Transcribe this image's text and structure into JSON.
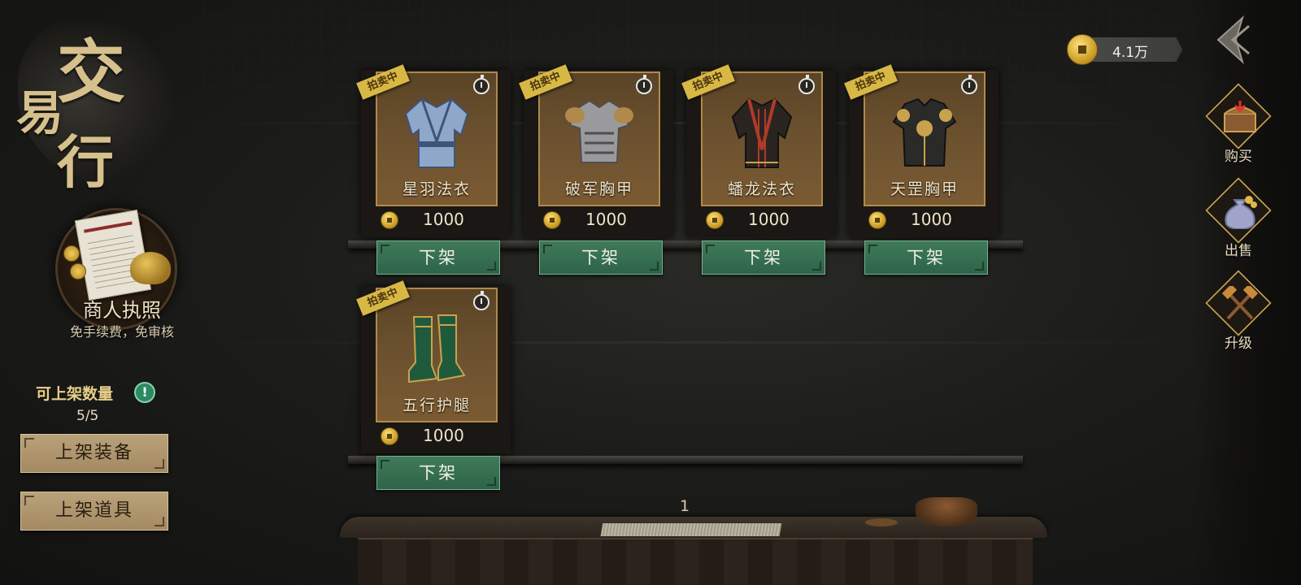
{
  "header": {
    "title_chars": [
      "交",
      "易",
      "行"
    ]
  },
  "license": {
    "title": "商人执照",
    "subtitle": "免手续费，免审核"
  },
  "listing": {
    "count_label": "可上架数量",
    "count_value": "5/5",
    "info_icon": "!",
    "buttons": {
      "list_equipment": "上架装备",
      "list_items": "上架道具"
    }
  },
  "currency": {
    "icon": "gold-coin-icon",
    "value": "4.1万"
  },
  "nav": {
    "buy": "购买",
    "sell": "出售",
    "upgrade": "升级"
  },
  "items": [
    {
      "name": "星羽法衣",
      "tag": "拍卖中",
      "price": "1000",
      "action": "下架",
      "icon": "robe-icon",
      "colors": [
        "#8fa8c9",
        "#3e5478"
      ]
    },
    {
      "name": "破军胸甲",
      "tag": "拍卖中",
      "price": "1000",
      "action": "下架",
      "icon": "armor-icon",
      "colors": [
        "#9a9a9c",
        "#4e4e50"
      ]
    },
    {
      "name": "蟠龙法衣",
      "tag": "拍卖中",
      "price": "1000",
      "action": "下架",
      "icon": "dragon-robe-icon",
      "colors": [
        "#2a2420",
        "#b03a2a"
      ]
    },
    {
      "name": "天罡胸甲",
      "tag": "拍卖中",
      "price": "1000",
      "action": "下架",
      "icon": "chest-armor-icon",
      "colors": [
        "#2a2a28",
        "#c9a24e"
      ]
    },
    {
      "name": "五行护腿",
      "tag": "拍卖中",
      "price": "1000",
      "action": "下架",
      "icon": "boots-icon",
      "colors": [
        "#1f5a3c",
        "#c9a24e"
      ]
    }
  ],
  "pagination": {
    "current_page": "1"
  }
}
